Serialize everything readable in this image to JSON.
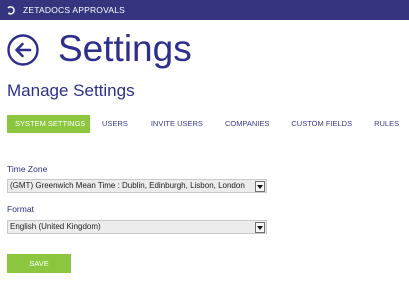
{
  "app": {
    "title": "ZETADOCS APPROVALS"
  },
  "header": {
    "title": "Settings"
  },
  "section": {
    "title": "Manage Settings"
  },
  "tabs": [
    {
      "label": "SYSTEM SETTINGS",
      "active": true
    },
    {
      "label": "USERS",
      "active": false
    },
    {
      "label": "INVITE USERS",
      "active": false
    },
    {
      "label": "COMPANIES",
      "active": false
    },
    {
      "label": "CUSTOM FIELDS",
      "active": false
    },
    {
      "label": "RULES",
      "active": false
    }
  ],
  "form": {
    "timezone": {
      "label": "Time Zone",
      "value": "(GMT) Greenwich Mean Time : Dublin, Edinburgh, Lisbon, London"
    },
    "format": {
      "label": "Format",
      "value": "English (United Kingdom)"
    },
    "save_label": "SAVE"
  },
  "colors": {
    "topbar": "#35357f",
    "accent": "#8cc63e",
    "title": "#2e2e8c"
  }
}
